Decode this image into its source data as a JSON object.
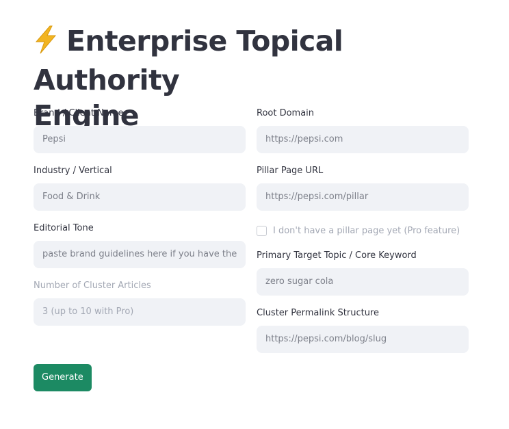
{
  "page": {
    "title_line1": "Enterprise Topical Authority",
    "title_line2": "Engine",
    "title_icon": "lightning-bolt-icon"
  },
  "form": {
    "brand": {
      "label": "Brand / Client Name",
      "placeholder": "Pepsi"
    },
    "domain": {
      "label": "Root Domain",
      "placeholder": "https://pepsi.com"
    },
    "industry": {
      "label": "Industry / Vertical",
      "placeholder": "Food & Drink"
    },
    "pillar_url": {
      "label": "Pillar Page URL",
      "placeholder": "https://pepsi.com/pillar"
    },
    "tone": {
      "label": "Editorial Tone",
      "placeholder": "paste brand guidelines here if you have them"
    },
    "no_pillar_checkbox": {
      "label": "I don't have a pillar page yet (Pro feature)",
      "checked": false
    },
    "cluster_count": {
      "label": "Number of Cluster Articles",
      "placeholder": "3 (up to 10 with Pro)",
      "disabled": true
    },
    "keyword": {
      "label": "Primary Target Topic / Core Keyword",
      "placeholder": "zero sugar cola"
    },
    "permalink": {
      "label": "Cluster Permalink Structure",
      "placeholder": "https://pepsi.com/blog/slug"
    }
  },
  "actions": {
    "generate_label": "Generate"
  },
  "colors": {
    "text": "#31333f",
    "input_bg": "#f0f2f6",
    "placeholder": "#7d808a",
    "disabled": "#a3a8b4",
    "button_bg": "#1c8a63",
    "bolt": "#f2b420"
  }
}
